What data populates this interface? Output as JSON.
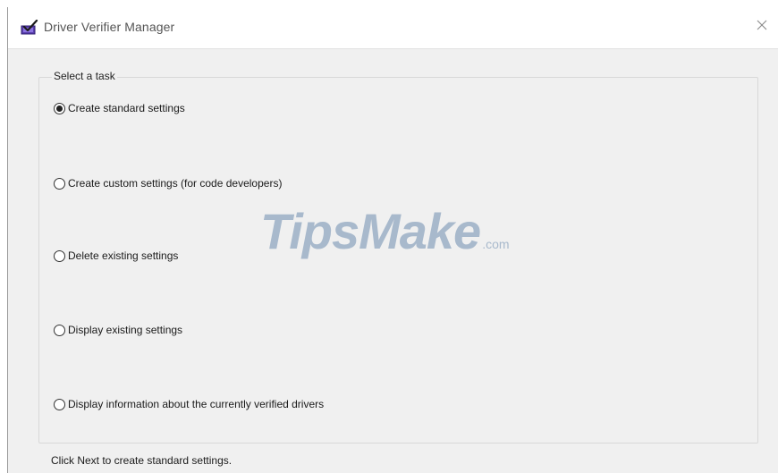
{
  "window": {
    "title": "Driver Verifier Manager",
    "icon": "driver-verifier-app-icon",
    "close_glyph": "✕"
  },
  "task_group": {
    "legend": "Select a task",
    "options": [
      {
        "label": "Create standard settings",
        "checked": true
      },
      {
        "label": "Create custom settings (for code developers)",
        "checked": false
      },
      {
        "label": "Delete existing settings",
        "checked": false
      },
      {
        "label": "Display existing settings",
        "checked": false
      },
      {
        "label": "Display information about the currently verified drivers",
        "checked": false
      }
    ]
  },
  "watermark": {
    "main": "TipsMake",
    "suffix": ".com"
  },
  "status": {
    "text": "Click Next to create standard settings."
  }
}
